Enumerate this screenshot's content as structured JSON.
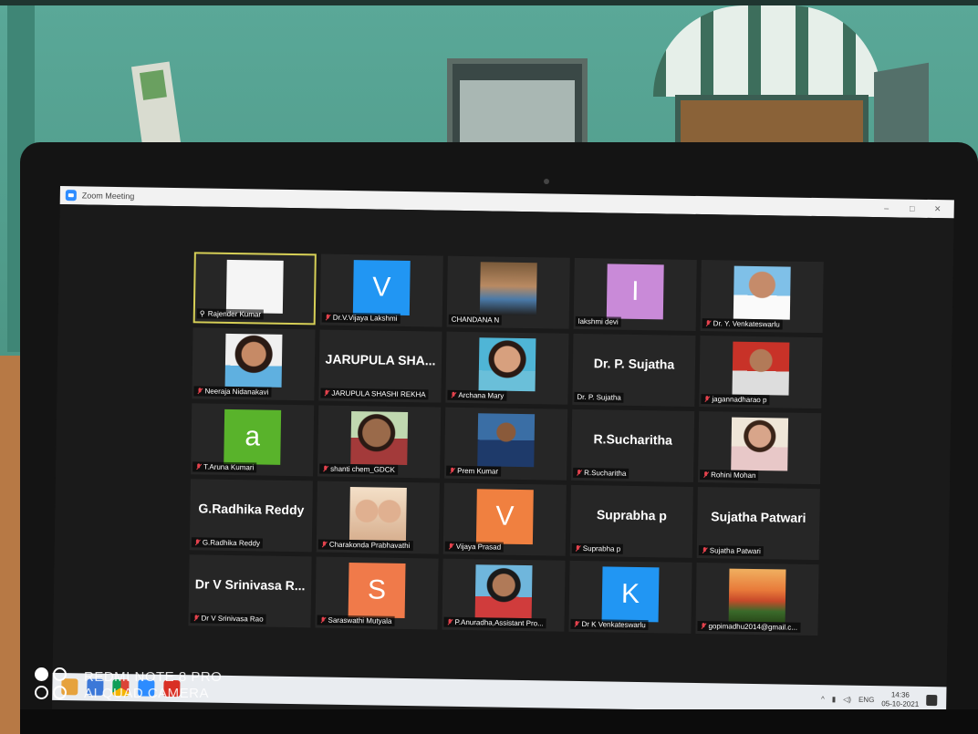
{
  "window": {
    "title": "Zoom Meeting",
    "controls": [
      "–",
      "□",
      "✕"
    ]
  },
  "participants": [
    {
      "name": "Rajender Kumar",
      "type": "blank",
      "pinned": true,
      "active": true
    },
    {
      "name": "Dr.V.Vijaya Lakshmi",
      "type": "letter",
      "letter": "V",
      "color": "#2196f3"
    },
    {
      "name": "CHANDANA N",
      "type": "photo",
      "photo": "selfie"
    },
    {
      "name": "lakshmi devi",
      "type": "letter",
      "letter": "I",
      "color": "#c98ad8"
    },
    {
      "name": "Dr. Y. Venkateswarlu",
      "type": "photo",
      "photo": "man"
    },
    {
      "name": "Neeraja Nidanakavi",
      "type": "photo",
      "photo": "woman"
    },
    {
      "name": "JARUPULA SHASHI REKHA",
      "type": "text",
      "display": "JARUPULA SHA..."
    },
    {
      "name": "Archana Mary",
      "type": "photo",
      "photo": "woman-glasses"
    },
    {
      "name": "Dr. P. Sujatha",
      "type": "text",
      "display": "Dr. P. Sujatha",
      "nomute": true
    },
    {
      "name": "jagannadharao p",
      "type": "photo",
      "photo": "man2"
    },
    {
      "name": "T.Aruna Kumari",
      "type": "letter",
      "letter": "a",
      "color": "#59b32b"
    },
    {
      "name": "shanti chem_GDCK",
      "type": "photo",
      "photo": "woman-outdoor"
    },
    {
      "name": "Prem Kumar",
      "type": "photo",
      "photo": "man-dark"
    },
    {
      "name": "R.Sucharitha",
      "type": "text",
      "display": "R.Sucharitha"
    },
    {
      "name": "Rohini Mohan",
      "type": "photo",
      "photo": "woman-light"
    },
    {
      "name": "G.Radhika Reddy",
      "type": "text",
      "display": "G.Radhika Reddy"
    },
    {
      "name": "Charakonda Prabhavathi",
      "type": "photo",
      "photo": "two-women"
    },
    {
      "name": "Vijaya Prasad",
      "type": "letter",
      "letter": "V",
      "color": "#f08040"
    },
    {
      "name": "Suprabha p",
      "type": "text",
      "display": "Suprabha p"
    },
    {
      "name": "Sujatha Patwari",
      "type": "text",
      "display": "Sujatha Patwari"
    },
    {
      "name": "Dr V Srinivasa Rao",
      "type": "text",
      "display": "Dr V Srinivasa R..."
    },
    {
      "name": "Saraswathi Mutyala",
      "type": "letter",
      "letter": "S",
      "color": "#f07a4a"
    },
    {
      "name": "P.Anuradha,Assistant Pro...",
      "type": "photo",
      "photo": "woman-saree"
    },
    {
      "name": "Dr K Venkateswarlu",
      "type": "letter",
      "letter": "K",
      "color": "#2196f3"
    },
    {
      "name": "gopimadhu2014@gmail.c...",
      "type": "photo",
      "photo": "temple"
    }
  ],
  "taskbar": {
    "tray": [
      "ENG"
    ],
    "time": "14:36",
    "date": "05-10-2021"
  },
  "watermark": {
    "line1": "REDMI NOTE 8 PRO",
    "line2": "AI QUAD CAMERA"
  },
  "colors": {
    "active_border": "#d6cf56",
    "muted_mic": "#e5424d",
    "zoom_blue": "#2d8cff"
  }
}
